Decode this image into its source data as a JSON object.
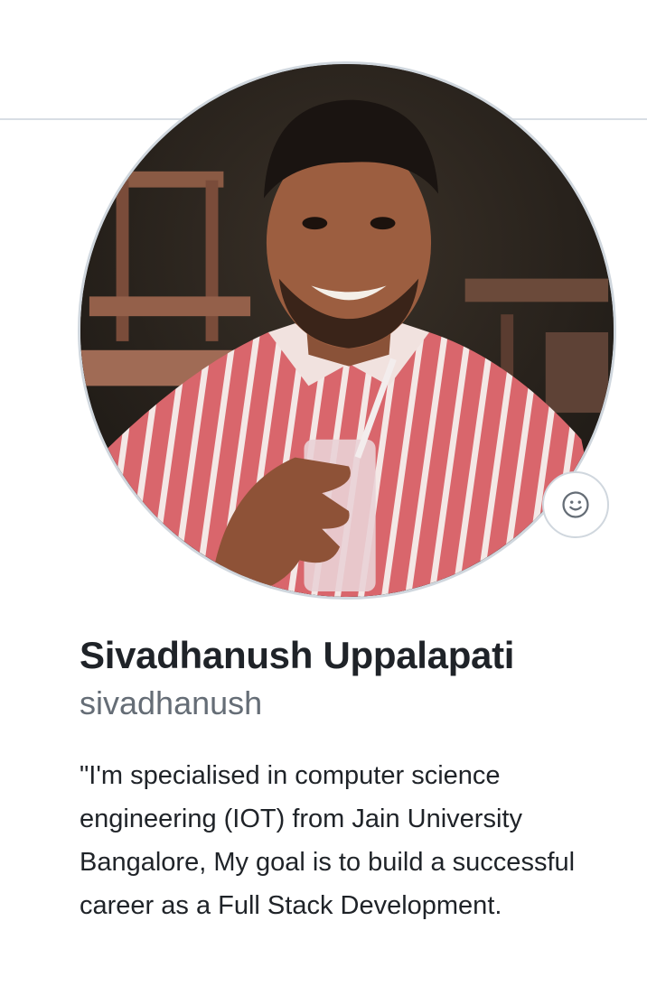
{
  "profile": {
    "full_name": "Sivadhanush Uppalapati",
    "username": "sivadhanush",
    "bio": "\"I'm specialised in computer science engineering (IOT) from Jain University Bangalore, My goal is to build a successful career as a Full Stack Development.",
    "avatar_alt": "Sivadhanush Uppalapati",
    "status_icon": "smiley-icon"
  },
  "colors": {
    "text_primary": "#1f2328",
    "text_muted": "#656d76",
    "border": "#d0d7de",
    "divider": "#d8dee4"
  }
}
